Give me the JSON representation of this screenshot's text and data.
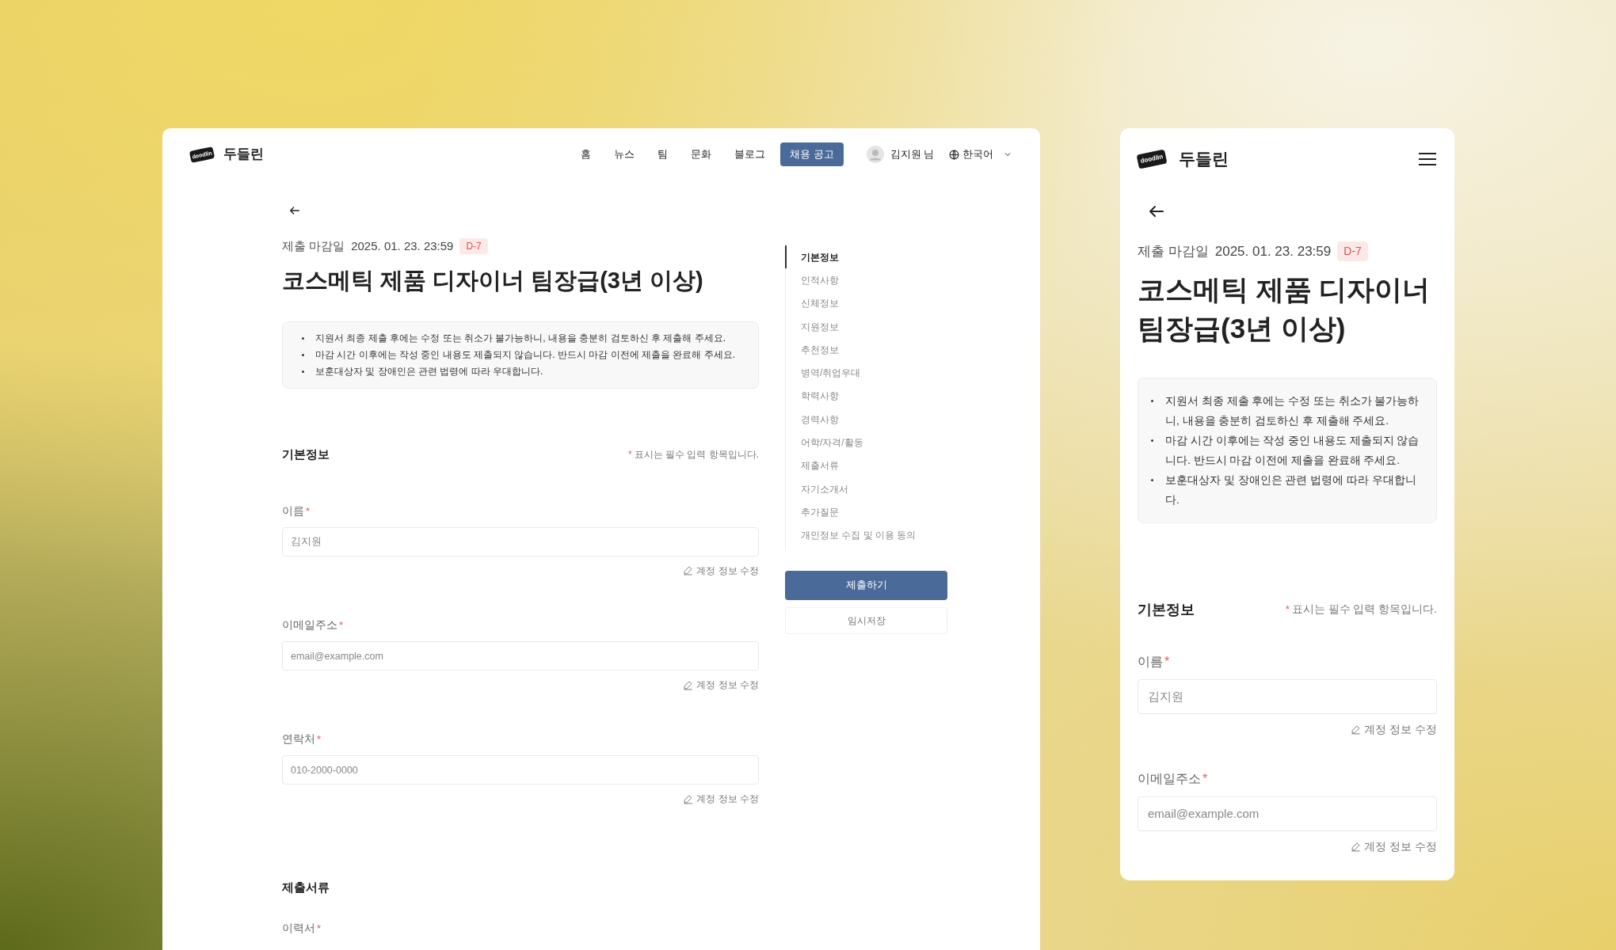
{
  "desktop": {
    "logo_text": "doodlin",
    "brand_name": "두들린",
    "nav": [
      {
        "label": "홈",
        "selected": false
      },
      {
        "label": "뉴스",
        "selected": false
      },
      {
        "label": "팀",
        "selected": false
      },
      {
        "label": "문화",
        "selected": false
      },
      {
        "label": "블로그",
        "selected": false
      },
      {
        "label": "채용 공고",
        "selected": true
      }
    ],
    "user_name": "김지원 님",
    "language": "한국어",
    "deadline": {
      "label": "제출 마감일",
      "date": "2025. 01. 23. 23:59",
      "badge": "D-7"
    },
    "title": "코스메틱 제품 디자이너 팀장급(3년 이상)",
    "notices": [
      "지원서 최종 제출 후에는 수정 또는 취소가 불가능하니, 내용을 충분히 검토하신 후 제출해 주세요.",
      "마감 시간 이후에는 작성 중인 내용도 제출되지 않습니다. 반드시 마감 이전에 제출을 완료해 주세요.",
      "보훈대상자 및 장애인은 관련 법령에 따라 우대합니다."
    ],
    "required_mark": "*",
    "sections": [
      {
        "title": "기본정보",
        "required_note": "표시는 필수 입력 항목입니다.",
        "fields": [
          {
            "label": "이름",
            "required": true,
            "placeholder": "김지원",
            "action": "계정 정보 수정"
          },
          {
            "label": "이메일주소",
            "required": true,
            "placeholder": "email@example.com",
            "action": "계정 정보 수정"
          },
          {
            "label": "연락처",
            "required": true,
            "placeholder": "010-2000-0000",
            "action": "계정 정보 수정"
          }
        ]
      },
      {
        "title": "제출서류",
        "fields": [
          {
            "label": "이력서",
            "required": true
          }
        ]
      }
    ],
    "toc": [
      {
        "label": "기본정보",
        "selected": true
      },
      {
        "label": "인적사항",
        "selected": false
      },
      {
        "label": "신체정보",
        "selected": false
      },
      {
        "label": "지원정보",
        "selected": false
      },
      {
        "label": "추천정보",
        "selected": false
      },
      {
        "label": "병역/취업우대",
        "selected": false
      },
      {
        "label": "학력사항",
        "selected": false
      },
      {
        "label": "경력사항",
        "selected": false
      },
      {
        "label": "어학/자격/활동",
        "selected": false
      },
      {
        "label": "제출서류",
        "selected": false
      },
      {
        "label": "자기소개서",
        "selected": false
      },
      {
        "label": "추가질문",
        "selected": false
      },
      {
        "label": "개인정보 수집 및 이용 동의",
        "selected": false
      }
    ],
    "submit": "제출하기",
    "save_draft": "임시저장"
  },
  "mobile": {
    "logo_text": "doodlin",
    "brand_name": "두들린",
    "deadline": {
      "label": "제출 마감일",
      "date": "2025. 01. 23. 23:59",
      "badge": "D-7"
    },
    "title": "코스메틱 제품 디자이너 팀장급(3년 이상)",
    "notices": [
      "지원서 최종 제출 후에는 수정 또는 취소가 불가능하니, 내용을 충분히 검토하신 후 제출해 주세요.",
      "마감 시간 이후에는 작성 중인 내용도 제출되지 않습니다. 반드시 마감 이전에 제출을 완료해 주세요.",
      "보훈대상자 및 장애인은 관련 법령에 따라 우대합니다."
    ],
    "required_mark": "*",
    "section": {
      "title": "기본정보",
      "required_note": "표시는 필수 입력 항목입니다.",
      "fields": [
        {
          "label": "이름",
          "required": true,
          "placeholder": "김지원",
          "action": "계정 정보 수정"
        },
        {
          "label": "이메일주소",
          "required": true,
          "placeholder": "email@example.com",
          "action": "계정 정보 수정"
        }
      ]
    }
  }
}
